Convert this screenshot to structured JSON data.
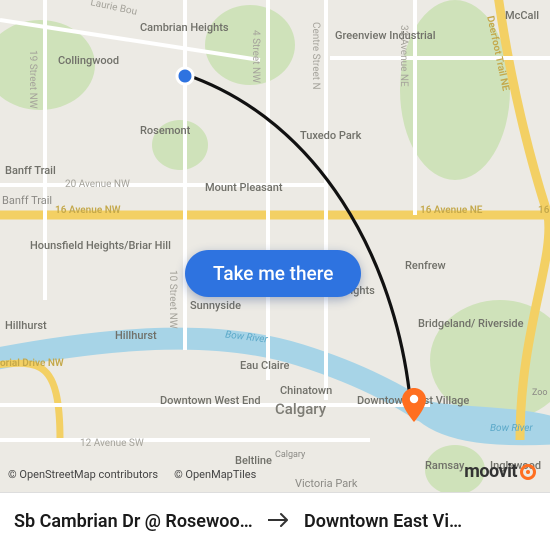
{
  "button": {
    "take_me_there": "Take me there"
  },
  "route": {
    "from": "Sb Cambrian Dr @ Rosewood …",
    "to": "Downtown East Vi…"
  },
  "attribution": {
    "osm": "© OpenStreetMap contributors",
    "omt": "© OpenMapTiles"
  },
  "brand": {
    "moovit": "moovit"
  },
  "labels": {
    "city": "Calgary",
    "cambrian_heights": "Cambrian\nHeights",
    "collingwood": "Collingwood",
    "greenview": "Greenview\nIndustrial",
    "mccall": "McCall",
    "rosemont": "Rosemont",
    "tuxedo": "Tuxedo Park",
    "banff_trail": "Banff Trail",
    "banff_trail2": "Banff\nTrail",
    "mount_pleasant": "Mount Pleasant",
    "hounsfield": "Hounsfield\nHeights/Briar Hill",
    "sunnyside": "Sunnyside",
    "crescent_heights": "Crescent\nHeights",
    "renfrew": "Renfrew",
    "hillhurst": "Hillhurst",
    "hillhurst2": "Hillhurst",
    "eau_claire": "Eau Claire",
    "bridgeland": "Bridgeland/\nRiverside",
    "chinatown": "Chinatown",
    "downtown_west": "Downtown\nWest End",
    "downtown_east": "Downtown\nEast Village",
    "beltline": "Beltline",
    "ramsay": "Ramsay",
    "inglewood": "Inglewood",
    "victoria_park": "Victoria Park",
    "calgary_sm": "Calgary",
    "zoo": "Zoo",
    "r_20ave": "20 Avenue NW",
    "r_16avenw": "16 Avenue NW",
    "r_16avene": "16 Avenue NE",
    "r_16": "16",
    "r_12ave": "12 Avenue SW",
    "r_laurie": "Laurie Bou",
    "r_4st": "4 Street NW",
    "r_centre": "Centre Street N",
    "r_19st": "19 Street NW",
    "r_10st": "10 Street NW",
    "r_32ave": "32 Avenue NE",
    "r_deerfoot": "Deerfoot Trail NE",
    "r_memorial": "orial Drive NW",
    "r_bow1": "Bow River",
    "r_bow2": "Bow River"
  },
  "colors": {
    "accent": "#2e73e0",
    "start_fill": "#2e73e0",
    "end_fill": "#ff6f20",
    "water": "#9fd2e8",
    "park": "#c9dfb3",
    "highway": "#f4cf5a",
    "arterial": "#ffffff",
    "route_line": "#111111"
  }
}
